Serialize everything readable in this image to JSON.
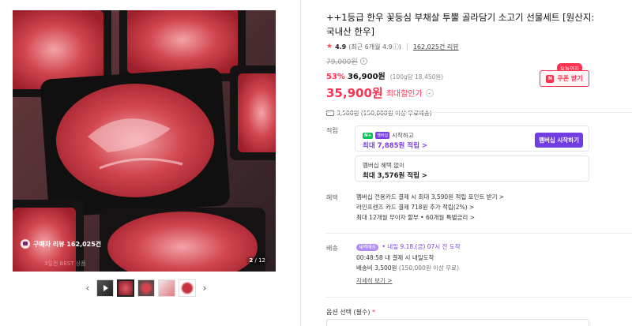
{
  "gallery": {
    "review_chip": "구매자 리뷰 162,025건",
    "fade_note": "3일전 BEST 상품",
    "counter_current": "2",
    "counter_total": "/ 12"
  },
  "product": {
    "title": "++1등급 한우 꽃등심 부채살 투뿔 골라담기 소고기 선물세트 [원산지:국내산 한우]",
    "rating": "4.9",
    "rating_recent": "(최근 6개월 4.9",
    "review_count": "162,025건 리뷰",
    "original_price": "79,000원",
    "discount_percent": "53%",
    "discount_price": "36,900원",
    "unit_price": "(100g당 18,450원)",
    "best_price": "35,900원",
    "best_label": "최대할인가",
    "shipping_note": "3,500원 (150,000원 이상 무료배송)",
    "today_badge": "오늘까지",
    "coupon_label": "쿠폰 받기"
  },
  "points": {
    "label": "적립",
    "npay": "N+",
    "mb": "멤버십",
    "start_text": "시작하고",
    "max_member": "최대 7,885원 적립 >",
    "member_button": "멤버십 시작하기",
    "no_member": "멤버십 혜택 없이",
    "max_basic": "최대 3,576원 적립 >"
  },
  "benefits": {
    "label": "혜택",
    "lines": [
      "멤버십 전용카드 결제 시 최대 3,590원 적립 포인트 받기 >",
      "라인프렌즈 카드 결제 718원 추가 적립(2%) >",
      "최대 12개월 무이자 할부 • 60개월 특별금리 >"
    ]
  },
  "delivery": {
    "label": "배송",
    "badge": "새벽배송",
    "dawn_line": "• 내일 9.18.(금) 07시 전 도착",
    "countdown": "00:48:58  내 결제 시 내일도착",
    "fee": "배송비 3,500원",
    "fee_note": "(150,000원 이상 무료)",
    "more": "자세히 보기 >"
  },
  "options": {
    "label": "옵션 선택 (필수)",
    "required_mark": "*"
  },
  "colors": {
    "accent": "#ff3250",
    "member": "#6f3de0"
  }
}
